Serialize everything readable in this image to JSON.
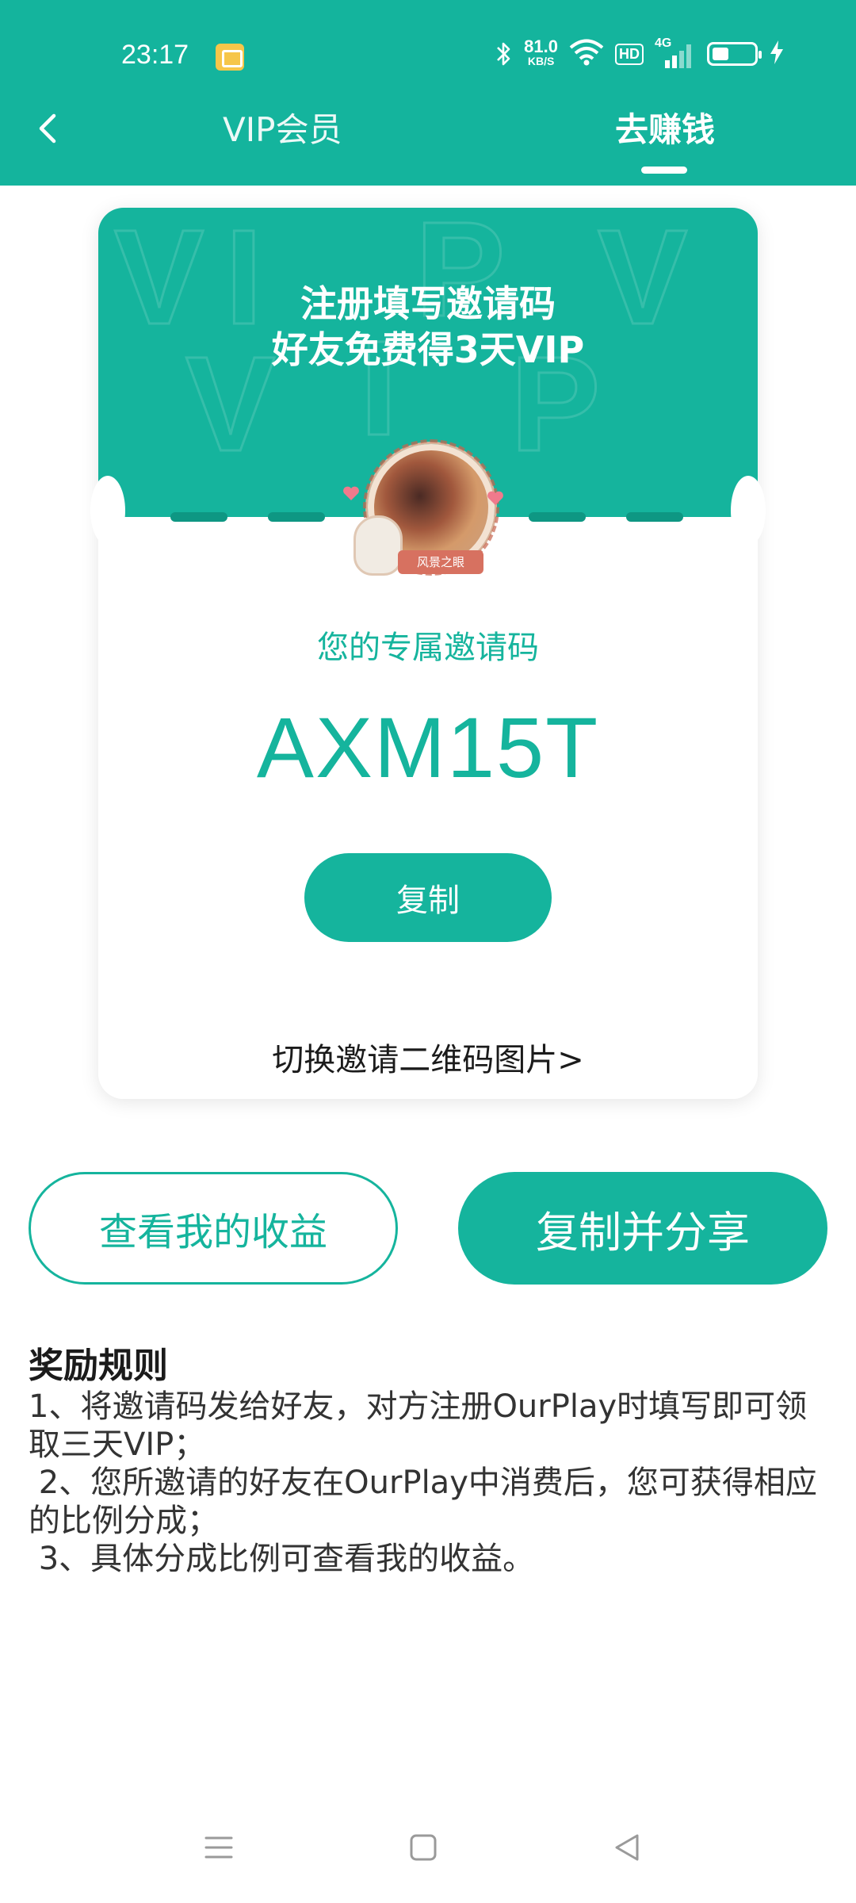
{
  "status_bar": {
    "time": "23:17",
    "speed_value": "81.0",
    "speed_unit": "KB/S",
    "hd": "HD",
    "network": "4G",
    "battery_percent": 25
  },
  "header": {
    "tabs": [
      {
        "label": "VIP会员",
        "active": false
      },
      {
        "label": "去赚钱",
        "active": true
      }
    ],
    "accent_color": "#14b49d"
  },
  "card": {
    "headline_line1": "注册填写邀请码",
    "headline_line2": "好友免费得3天VIP",
    "bg_letters": [
      "V",
      "I",
      "P",
      "V",
      "V",
      "I",
      "P"
    ],
    "avatar_badge": "风景之眼",
    "code_label": "您的专属邀请码",
    "code": "AXM15T",
    "copy_button": "复制",
    "switch_link": "切换邀请二维码图片>"
  },
  "actions": {
    "view_earnings": "查看我的收益",
    "copy_share": "复制并分享"
  },
  "rules": {
    "title": "奖励规则",
    "items": [
      "1、将邀请码发给好友，对方注册OurPlay时填写即可领取三天VIP；",
      " 2、您所邀请的好友在OurPlay中消费后，您可获得相应的比例分成；",
      " 3、具体分成比例可查看我的收益。"
    ]
  },
  "icons": {
    "back": "chevron-left-icon",
    "menu": "menu-icon",
    "home": "home-icon",
    "back_nav": "triangle-back-icon"
  }
}
